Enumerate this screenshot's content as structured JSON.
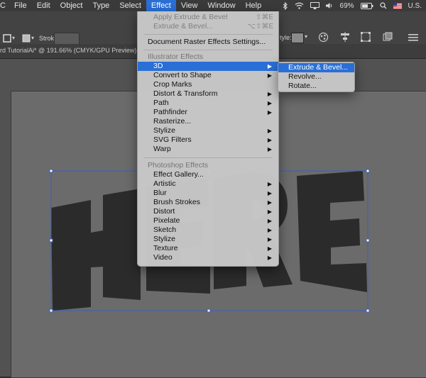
{
  "menubar": {
    "items": [
      "C",
      "File",
      "Edit",
      "Object",
      "Type",
      "Select",
      "Effect",
      "View",
      "Window",
      "Help"
    ],
    "battery": "69%",
    "input_source": "U.S."
  },
  "toolbar": {
    "stroke_label": "Stroke:",
    "style_label": "tyle:"
  },
  "document": {
    "tab_title": "rd TutorialAi* @ 191.66% (CMYK/GPU Preview)"
  },
  "artwork": {
    "text": "HERE"
  },
  "effect_menu": {
    "apply_label": "Apply Extrude & Bevel",
    "apply_shortcut": "⇧⌘E",
    "last_label": "Extrude & Bevel...",
    "last_shortcut": "⌥⇧⌘E",
    "doc_raster": "Document Raster Effects Settings...",
    "illustrator_header": "Illustrator Effects",
    "illustrator_items": [
      "3D",
      "Convert to Shape",
      "Crop Marks",
      "Distort & Transform",
      "Path",
      "Pathfinder",
      "Rasterize...",
      "Stylize",
      "SVG Filters",
      "Warp"
    ],
    "photoshop_header": "Photoshop Effects",
    "photoshop_items": [
      "Effect Gallery...",
      "Artistic",
      "Blur",
      "Brush Strokes",
      "Distort",
      "Pixelate",
      "Sketch",
      "Stylize",
      "Texture",
      "Video"
    ]
  },
  "submenu_3d": {
    "items": [
      "Extrude & Bevel...",
      "Revolve...",
      "Rotate..."
    ]
  }
}
